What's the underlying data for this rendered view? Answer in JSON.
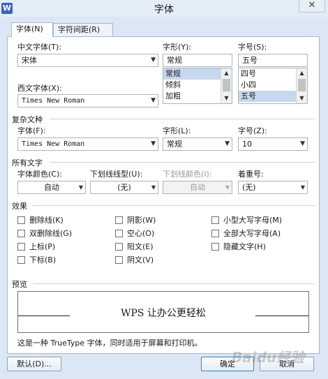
{
  "window": {
    "title": "字体",
    "close_glyph": "✕",
    "app_icon_letter": "W"
  },
  "tabs": [
    {
      "label": "字体(N)"
    },
    {
      "label": "字符间距(R)"
    }
  ],
  "chinese_font": {
    "label": "中文字体(T):",
    "value": "宋体"
  },
  "western_font": {
    "label": "西文字体(X):",
    "value": "Times New Roman"
  },
  "style": {
    "label": "字形(Y):",
    "value": "常规",
    "options": [
      {
        "label": "常规"
      },
      {
        "label": "倾斜"
      },
      {
        "label": "加粗"
      }
    ]
  },
  "size": {
    "label": "字号(S):",
    "value": "五号",
    "options": [
      {
        "label": "四号"
      },
      {
        "label": "小四"
      },
      {
        "label": "五号"
      }
    ]
  },
  "complex": {
    "heading": "复杂文种",
    "font_label": "字体(F):",
    "font_value": "Times New Roman",
    "style_label": "字形(L):",
    "style_value": "常规",
    "size_label": "字号(Z):",
    "size_value": "10"
  },
  "all_text": {
    "heading": "所有文字",
    "color_label": "字体颜色(C):",
    "color_value": "自动",
    "underline_label": "下划线线型(U):",
    "underline_value": "(无)",
    "underline_color_label": "下划线颜色(I):",
    "underline_color_value": "自动",
    "emphasis_label": "着重号:",
    "emphasis_value": "(无)"
  },
  "effects": {
    "heading": "效果",
    "col1": [
      {
        "label": "删除线(K)"
      },
      {
        "label": "双删除线(G)"
      },
      {
        "label": "上标(P)"
      },
      {
        "label": "下标(B)"
      }
    ],
    "col2": [
      {
        "label": "阴影(W)"
      },
      {
        "label": "空心(O)"
      },
      {
        "label": "阳文(E)"
      },
      {
        "label": "阴文(V)"
      }
    ],
    "col3": [
      {
        "label": "小型大写字母(M)"
      },
      {
        "label": "全部大写字母(A)"
      },
      {
        "label": "隐藏文字(H)"
      }
    ]
  },
  "preview": {
    "heading": "预览",
    "sample_text": "WPS 让办公更轻松",
    "note": "这是一种 TrueType 字体，同时适用于屏幕和打印机。"
  },
  "buttons": {
    "default": "默认(D)...",
    "ok": "确定",
    "cancel": "取消"
  },
  "watermark": "Baidu经验"
}
